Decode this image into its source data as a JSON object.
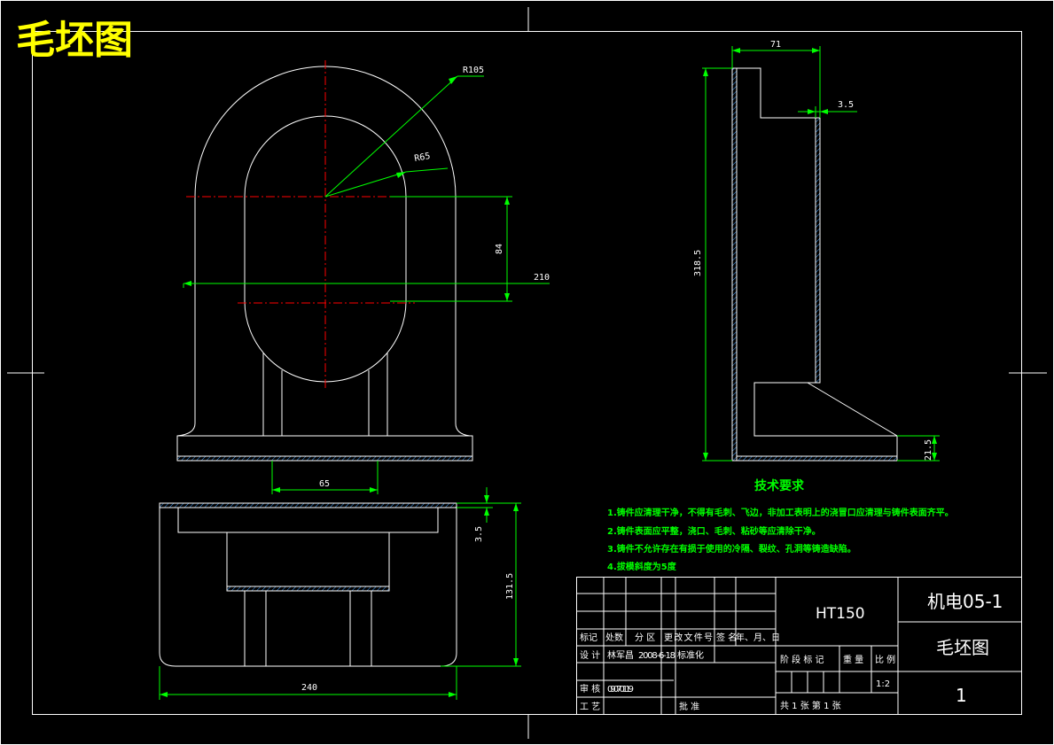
{
  "title": "毛坯图",
  "dimensions": {
    "r105": "R105",
    "r65": "R65",
    "d84": "84",
    "d210": "210",
    "d65": "65",
    "d71": "71",
    "d3_5_side": "3.5",
    "d318_5": "318.5",
    "d21_5": "21.5",
    "d3_5_bottom": "3.5",
    "d131_5": "131.5",
    "d240": "240"
  },
  "requirements": {
    "heading": "技术要求",
    "items": [
      "1.铸件应清理干净，不得有毛刺、飞边，非加工表明上的浇冒口应清理与铸件表面齐平。",
      "2.铸件表面应平整，浇口、毛刺、粘砂等应清除干净。",
      "3.铸件不允许存在有损于使用的冷隔、裂纹、孔洞等铸造缺陷。",
      "4.拔模斜度为5度"
    ]
  },
  "title_block": {
    "material": "HT150",
    "class_code": "机电05-1",
    "drawing_name": "毛坯图",
    "drawing_number": "1",
    "header_row": [
      "标记",
      "处数",
      "分 区",
      "更改文件号",
      "签 名",
      "年、月、日"
    ],
    "design_label": "设 计",
    "designer": "林军昌",
    "design_date": "2008-6-18",
    "standardize_label": "标准化",
    "review_label": "审 核",
    "review_value": "09070119",
    "process_label": "工 艺",
    "approve_label": "批 准",
    "stage_labels": [
      "阶 段 标 记",
      "重 量",
      "比 例"
    ],
    "scale": "1:2",
    "sheets": "共 1  张   第  1 张"
  },
  "colors": {
    "outline": "#ffffff",
    "dimension": "#00ff00",
    "centerline": "#ff0000",
    "hatch": "#40a0ff",
    "title": "#ffff00"
  }
}
